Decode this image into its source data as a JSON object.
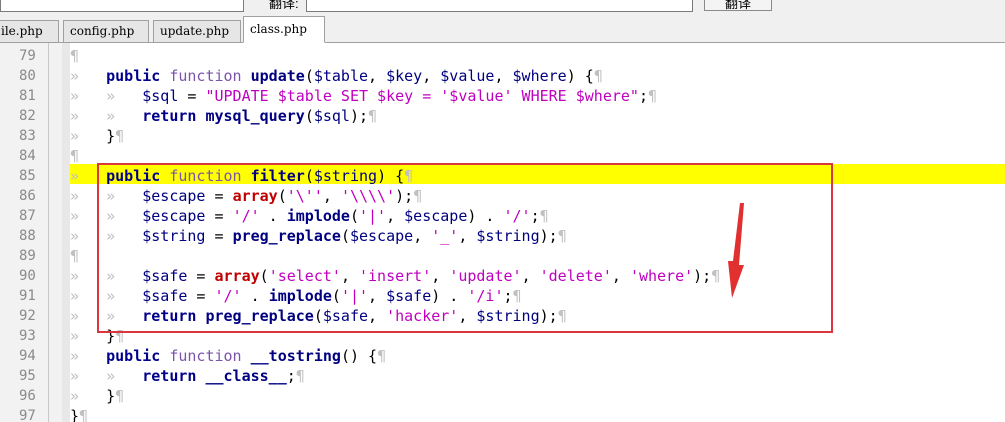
{
  "toolbar": {
    "label": "翻译:",
    "button_label": "翻译",
    "search_value": "",
    "replace_value": ""
  },
  "tabs": [
    {
      "label": "ile.php",
      "active": false
    },
    {
      "label": "config.php",
      "active": false
    },
    {
      "label": "update.php",
      "active": false
    },
    {
      "label": "class.php",
      "active": true
    }
  ],
  "editor": {
    "highlighted_line": 85,
    "lines": [
      {
        "n": "79",
        "t": ""
      },
      {
        "n": "80",
        "t": "public function update($table, $key, $value, $where) {"
      },
      {
        "n": "81",
        "t": "$sql = \"UPDATE $table SET $key = '$value' WHERE $where\";"
      },
      {
        "n": "82",
        "t": "return mysql_query($sql);"
      },
      {
        "n": "83",
        "t": "}"
      },
      {
        "n": "84",
        "t": ""
      },
      {
        "n": "85",
        "t": "public function filter($string) {"
      },
      {
        "n": "86",
        "t": "$escape = array('\\'', '\\\\\\\\');"
      },
      {
        "n": "87",
        "t": "$escape = '/' . implode('|', $escape) . '/';"
      },
      {
        "n": "88",
        "t": "$string = preg_replace($escape, '_', $string);"
      },
      {
        "n": "89",
        "t": ""
      },
      {
        "n": "90",
        "t": "$safe = array('select', 'insert', 'update', 'delete', 'where');"
      },
      {
        "n": "91",
        "t": "$safe = '/' . implode('|', $safe) . '/i';"
      },
      {
        "n": "92",
        "t": "return preg_replace($safe, 'hacker', $string);"
      },
      {
        "n": "93",
        "t": "}"
      },
      {
        "n": "94",
        "t": "public function __tostring() {"
      },
      {
        "n": "95",
        "t": "return __class__;"
      },
      {
        "n": "96",
        "t": "}"
      },
      {
        "n": "97",
        "t": "}"
      }
    ]
  },
  "colors": {
    "highlight": "#ffff00",
    "annotation": "#d9363e",
    "keyword": "#00008b",
    "string": "#c000c0",
    "array_keyword": "#c00000"
  },
  "icons": {
    "annotation_arrow": "red-arrow-icon",
    "pilcrow": "pilcrow-icon",
    "tab_marker": "tab-arrow-icon"
  }
}
